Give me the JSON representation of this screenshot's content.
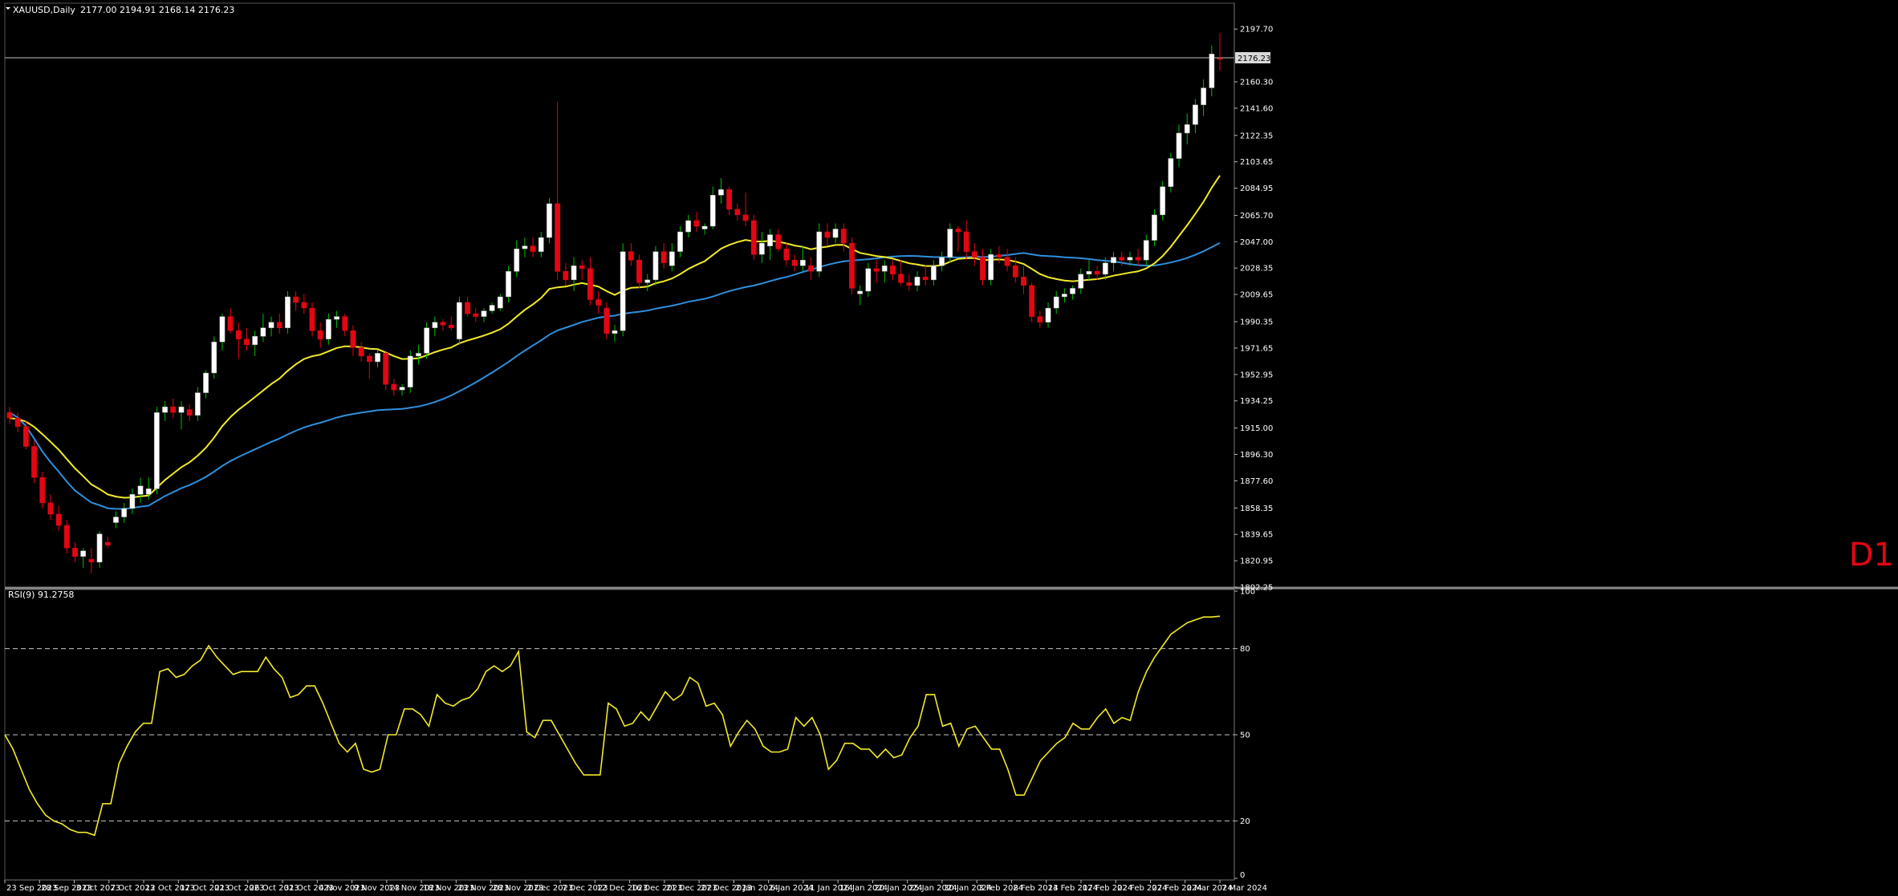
{
  "header": {
    "symbol": "XAUUSD,Daily",
    "ohlc": "2177.00 2194.91 2168.14 2176.23"
  },
  "timeframe_badge": "D1",
  "rsi_header": "RSI(9) 91.2758",
  "current_price_tag": "2176.23",
  "colors": {
    "background": "#000000",
    "bull_candle": "#ffffff",
    "bear_candle": "#e30613",
    "ma_fast": "#f2ea2b",
    "ma_slow": "#2f8fdc",
    "rsi_line": "#f2ea2b",
    "grid": "#ffffff",
    "wick_bull": "#00c000"
  },
  "chart_data": [
    {
      "type": "candlestick",
      "symbol": "XAUUSD",
      "timeframe": "Daily",
      "ylim": [
        1802.25,
        2216.0
      ],
      "y_ticks": [
        "2197.70",
        "2176.23",
        "2160.30",
        "2141.60",
        "2122.35",
        "2103.65",
        "2084.95",
        "2065.70",
        "2047.00",
        "2028.35",
        "2009.65",
        "1990.35",
        "1971.65",
        "1952.95",
        "1934.25",
        "1915.00",
        "1896.30",
        "1877.60",
        "1858.35",
        "1839.65",
        "1820.95",
        "1802.25"
      ],
      "x_labels": [
        "23 Sep 2023",
        "28 Sep 2023",
        "3 Oct 2023",
        "7 Oct 2023",
        "12 Oct 2023",
        "17 Oct 2023",
        "21 Oct 2023",
        "26 Oct 2023",
        "31 Oct 2023",
        "4 Nov 2023",
        "9 Nov 2023",
        "14 Nov 2023",
        "18 Nov 2023",
        "23 Nov 2023",
        "28 Nov 2023",
        "2 Dec 2023",
        "7 Dec 2023",
        "12 Dec 2023",
        "16 Dec 2023",
        "21 Dec 2023",
        "27 Dec 2023",
        "2 Jan 2024",
        "6 Jan 2024",
        "11 Jan 2024",
        "16 Jan 2024",
        "20 Jan 2024",
        "25 Jan 2024",
        "30 Jan 2024",
        "3 Feb 2024",
        "8 Feb 2024",
        "13 Feb 2024",
        "17 Feb 2024",
        "22 Feb 2024",
        "27 Feb 2024",
        "2 Mar 2024",
        "7 Mar 2024"
      ],
      "candles": [
        [
          1926,
          1930,
          1918,
          1922
        ],
        [
          1922,
          1926,
          1912,
          1916
        ],
        [
          1916,
          1920,
          1900,
          1902
        ],
        [
          1902,
          1906,
          1876,
          1880
        ],
        [
          1880,
          1884,
          1858,
          1862
        ],
        [
          1862,
          1868,
          1850,
          1854
        ],
        [
          1854,
          1860,
          1842,
          1846
        ],
        [
          1846,
          1850,
          1826,
          1830
        ],
        [
          1830,
          1834,
          1820,
          1824
        ],
        [
          1824,
          1830,
          1816,
          1828
        ],
        [
          1822,
          1830,
          1812,
          1820
        ],
        [
          1820,
          1842,
          1816,
          1840
        ],
        [
          1834,
          1838,
          1830,
          1832
        ],
        [
          1848,
          1856,
          1844,
          1852
        ],
        [
          1852,
          1862,
          1848,
          1858
        ],
        [
          1858,
          1872,
          1854,
          1868
        ],
        [
          1868,
          1880,
          1862,
          1874
        ],
        [
          1868,
          1880,
          1864,
          1872
        ],
        [
          1872,
          1930,
          1868,
          1926
        ],
        [
          1926,
          1934,
          1920,
          1930
        ],
        [
          1930,
          1936,
          1922,
          1926
        ],
        [
          1926,
          1934,
          1914,
          1930
        ],
        [
          1928,
          1932,
          1920,
          1924
        ],
        [
          1924,
          1944,
          1920,
          1940
        ],
        [
          1940,
          1956,
          1936,
          1954
        ],
        [
          1954,
          1980,
          1950,
          1976
        ],
        [
          1976,
          1996,
          1970,
          1994
        ],
        [
          1994,
          2000,
          1982,
          1984
        ],
        [
          1984,
          1990,
          1964,
          1978
        ],
        [
          1978,
          1986,
          1970,
          1974
        ],
        [
          1974,
          1984,
          1966,
          1980
        ],
        [
          1980,
          1996,
          1976,
          1986
        ],
        [
          1986,
          1994,
          1980,
          1990
        ],
        [
          1990,
          1996,
          1982,
          1986
        ],
        [
          1986,
          2012,
          1982,
          2008
        ],
        [
          2008,
          2012,
          1998,
          2004
        ],
        [
          2004,
          2010,
          1996,
          2000
        ],
        [
          2000,
          2004,
          1980,
          1984
        ],
        [
          1984,
          1990,
          1972,
          1978
        ],
        [
          1978,
          1996,
          1974,
          1992
        ],
        [
          1992,
          1998,
          1986,
          1994
        ],
        [
          1994,
          1996,
          1980,
          1984
        ],
        [
          1984,
          1988,
          1966,
          1972
        ],
        [
          1972,
          1976,
          1962,
          1966
        ],
        [
          1966,
          1968,
          1950,
          1962
        ],
        [
          1962,
          1970,
          1958,
          1968
        ],
        [
          1968,
          1970,
          1942,
          1946
        ],
        [
          1946,
          1950,
          1938,
          1942
        ],
        [
          1942,
          1946,
          1938,
          1944
        ],
        [
          1944,
          1970,
          1940,
          1966
        ],
        [
          1966,
          1974,
          1960,
          1968
        ],
        [
          1968,
          1990,
          1964,
          1986
        ],
        [
          1986,
          1994,
          1980,
          1990
        ],
        [
          1990,
          1992,
          1984,
          1988
        ],
        [
          1988,
          1994,
          1984,
          1986
        ],
        [
          1978,
          2008,
          1974,
          2004
        ],
        [
          2004,
          2008,
          1994,
          1996
        ],
        [
          1996,
          2000,
          1990,
          1994
        ],
        [
          1994,
          2000,
          1990,
          1998
        ],
        [
          1998,
          2004,
          1996,
          2002
        ],
        [
          2000,
          2010,
          1998,
          2008
        ],
        [
          2008,
          2030,
          2004,
          2026
        ],
        [
          2026,
          2048,
          2022,
          2042
        ],
        [
          2042,
          2050,
          2036,
          2044
        ],
        [
          2044,
          2050,
          2036,
          2040
        ],
        [
          2040,
          2054,
          2036,
          2050
        ],
        [
          2050,
          2078,
          2046,
          2074
        ],
        [
          2074,
          2146,
          2020,
          2026
        ],
        [
          2026,
          2032,
          2016,
          2020
        ],
        [
          2020,
          2036,
          2012,
          2030
        ],
        [
          2030,
          2034,
          2020,
          2028
        ],
        [
          2028,
          2036,
          2002,
          2006
        ],
        [
          2006,
          2012,
          1996,
          2002
        ],
        [
          2000,
          2004,
          1978,
          1982
        ],
        [
          1982,
          1988,
          1976,
          1984
        ],
        [
          1984,
          2046,
          1980,
          2040
        ],
        [
          2040,
          2046,
          2030,
          2034
        ],
        [
          2034,
          2038,
          2014,
          2018
        ],
        [
          2018,
          2024,
          2012,
          2020
        ],
        [
          2020,
          2044,
          2016,
          2040
        ],
        [
          2040,
          2046,
          2028,
          2032
        ],
        [
          2030,
          2046,
          2026,
          2040
        ],
        [
          2040,
          2058,
          2036,
          2054
        ],
        [
          2054,
          2066,
          2050,
          2062
        ],
        [
          2062,
          2068,
          2054,
          2058
        ],
        [
          2056,
          2060,
          2052,
          2058
        ],
        [
          2058,
          2086,
          2056,
          2080
        ],
        [
          2080,
          2092,
          2074,
          2084
        ],
        [
          2084,
          2086,
          2066,
          2070
        ],
        [
          2070,
          2074,
          2062,
          2066
        ],
        [
          2066,
          2082,
          2058,
          2062
        ],
        [
          2062,
          2066,
          2034,
          2038
        ],
        [
          2038,
          2054,
          2032,
          2046
        ],
        [
          2044,
          2056,
          2034,
          2052
        ],
        [
          2052,
          2056,
          2040,
          2042
        ],
        [
          2042,
          2046,
          2030,
          2034
        ],
        [
          2034,
          2038,
          2026,
          2030
        ],
        [
          2030,
          2044,
          2026,
          2034
        ],
        [
          2030,
          2036,
          2020,
          2026
        ],
        [
          2026,
          2060,
          2022,
          2054
        ],
        [
          2054,
          2060,
          2044,
          2050
        ],
        [
          2050,
          2060,
          2046,
          2056
        ],
        [
          2056,
          2060,
          2040,
          2046
        ],
        [
          2046,
          2050,
          2010,
          2014
        ],
        [
          2010,
          2016,
          2002,
          2012
        ],
        [
          2012,
          2032,
          2008,
          2028
        ],
        [
          2028,
          2034,
          2018,
          2026
        ],
        [
          2026,
          2034,
          2018,
          2030
        ],
        [
          2030,
          2034,
          2020,
          2024
        ],
        [
          2024,
          2034,
          2016,
          2018
        ],
        [
          2018,
          2024,
          2012,
          2016
        ],
        [
          2016,
          2026,
          2012,
          2022
        ],
        [
          2022,
          2030,
          2016,
          2020
        ],
        [
          2020,
          2034,
          2016,
          2030
        ],
        [
          2030,
          2040,
          2026,
          2036
        ],
        [
          2036,
          2060,
          2032,
          2056
        ],
        [
          2056,
          2058,
          2040,
          2054
        ],
        [
          2054,
          2062,
          2034,
          2040
        ],
        [
          2040,
          2046,
          2030,
          2036
        ],
        [
          2036,
          2042,
          2016,
          2020
        ],
        [
          2020,
          2042,
          2016,
          2038
        ],
        [
          2038,
          2044,
          2032,
          2036
        ],
        [
          2036,
          2042,
          2026,
          2030
        ],
        [
          2030,
          2036,
          2018,
          2022
        ],
        [
          2022,
          2030,
          2010,
          2016
        ],
        [
          2016,
          2018,
          1990,
          1994
        ],
        [
          1994,
          1998,
          1986,
          1990
        ],
        [
          1990,
          2004,
          1986,
          2000
        ],
        [
          2000,
          2012,
          1996,
          2008
        ],
        [
          2008,
          2014,
          2004,
          2010
        ],
        [
          2010,
          2016,
          2006,
          2014
        ],
        [
          2014,
          2028,
          2010,
          2024
        ],
        [
          2024,
          2034,
          2020,
          2026
        ],
        [
          2026,
          2030,
          2020,
          2024
        ],
        [
          2024,
          2036,
          2020,
          2032
        ],
        [
          2032,
          2040,
          2026,
          2036
        ],
        [
          2036,
          2040,
          2030,
          2034
        ],
        [
          2034,
          2040,
          2030,
          2036
        ],
        [
          2036,
          2042,
          2030,
          2034
        ],
        [
          2034,
          2052,
          2030,
          2048
        ],
        [
          2048,
          2070,
          2044,
          2066
        ],
        [
          2066,
          2090,
          2062,
          2086
        ],
        [
          2086,
          2110,
          2082,
          2106
        ],
        [
          2106,
          2130,
          2100,
          2124
        ],
        [
          2124,
          2138,
          2116,
          2130
        ],
        [
          2130,
          2148,
          2124,
          2144
        ],
        [
          2144,
          2162,
          2136,
          2156
        ],
        [
          2156,
          2186,
          2150,
          2180
        ],
        [
          2177.0,
          2194.91,
          2168.14,
          2176.23
        ]
      ]
    },
    {
      "type": "line",
      "name": "RSI(9) 91.2758",
      "ylim": [
        0,
        100
      ],
      "levels": [
        80,
        50,
        20
      ],
      "y_ticks": [
        "100",
        "80",
        "50",
        "20",
        "0"
      ],
      "values": [
        50,
        45,
        38,
        31,
        26,
        22,
        20,
        19,
        17,
        16,
        16,
        15,
        26,
        26,
        40,
        46,
        51,
        54,
        54,
        72,
        73,
        70,
        71,
        74,
        76,
        81,
        77,
        74,
        71,
        72,
        72,
        72,
        77,
        73,
        70,
        63,
        64,
        67,
        67,
        61,
        54,
        47,
        44,
        47,
        38,
        37,
        38,
        50,
        50,
        59,
        59,
        57,
        53,
        64,
        61,
        60,
        62,
        63,
        66,
        72,
        74,
        72,
        74,
        79,
        51,
        49,
        55,
        55,
        50,
        45,
        40,
        36,
        36,
        36,
        61,
        59,
        53,
        54,
        58,
        55,
        60,
        65,
        62,
        64,
        70,
        68,
        60,
        61,
        57,
        46,
        51,
        55,
        52,
        46,
        44,
        44,
        45,
        56,
        53,
        56,
        50,
        38,
        41,
        47,
        47,
        45,
        45,
        42,
        45,
        42,
        43,
        49,
        53,
        64,
        64,
        53,
        54,
        46,
        52,
        53,
        49,
        45,
        45,
        38,
        29,
        29,
        35,
        41,
        44,
        47,
        49,
        54,
        52,
        52,
        56,
        59,
        54,
        56,
        55,
        65,
        72,
        77,
        81,
        85,
        87,
        89,
        90,
        91,
        91,
        91.28
      ]
    }
  ]
}
